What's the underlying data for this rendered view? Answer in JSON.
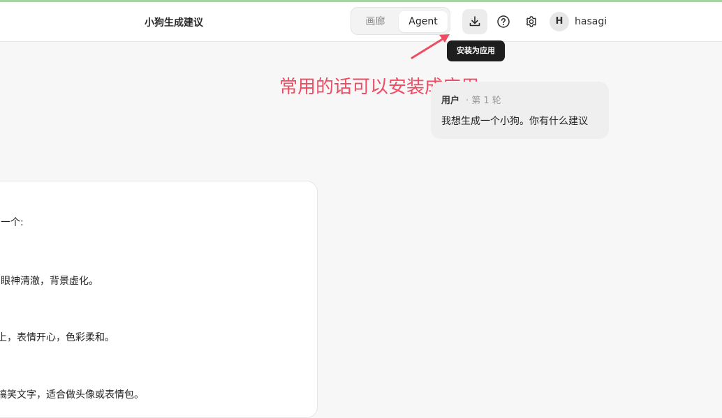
{
  "header": {
    "title": "小狗生成建议",
    "mode_tabs": {
      "gallery": "画廊",
      "agent": "Agent",
      "active": "Agent"
    },
    "actions": {
      "install_icon": "download-icon",
      "help_icon": "help-circle-icon",
      "settings_icon": "gear-icon"
    },
    "user": {
      "avatar_initial": "H",
      "name": "hasagi"
    }
  },
  "tooltip": {
    "install_label": "安装为应用"
  },
  "annotation": {
    "text": "常用的话可以安装成应用",
    "color": "#ef4b62"
  },
  "conversation": {
    "user_message": {
      "author": "用户",
      "meta": "· 第 1 轮",
      "text": "我想生成一个小狗。你有什么建议"
    },
    "assistant_message": {
      "lines": [
        "一个:",
        "眼神清澈，背景虚化。",
        "上，表情开心，色彩柔和。",
        "搞笑文字，适合做头像或表情包。"
      ]
    }
  },
  "colors": {
    "top_accent": "#a6d3a3",
    "background": "#f7f7f7",
    "tooltip_bg": "#1e1e1e"
  }
}
